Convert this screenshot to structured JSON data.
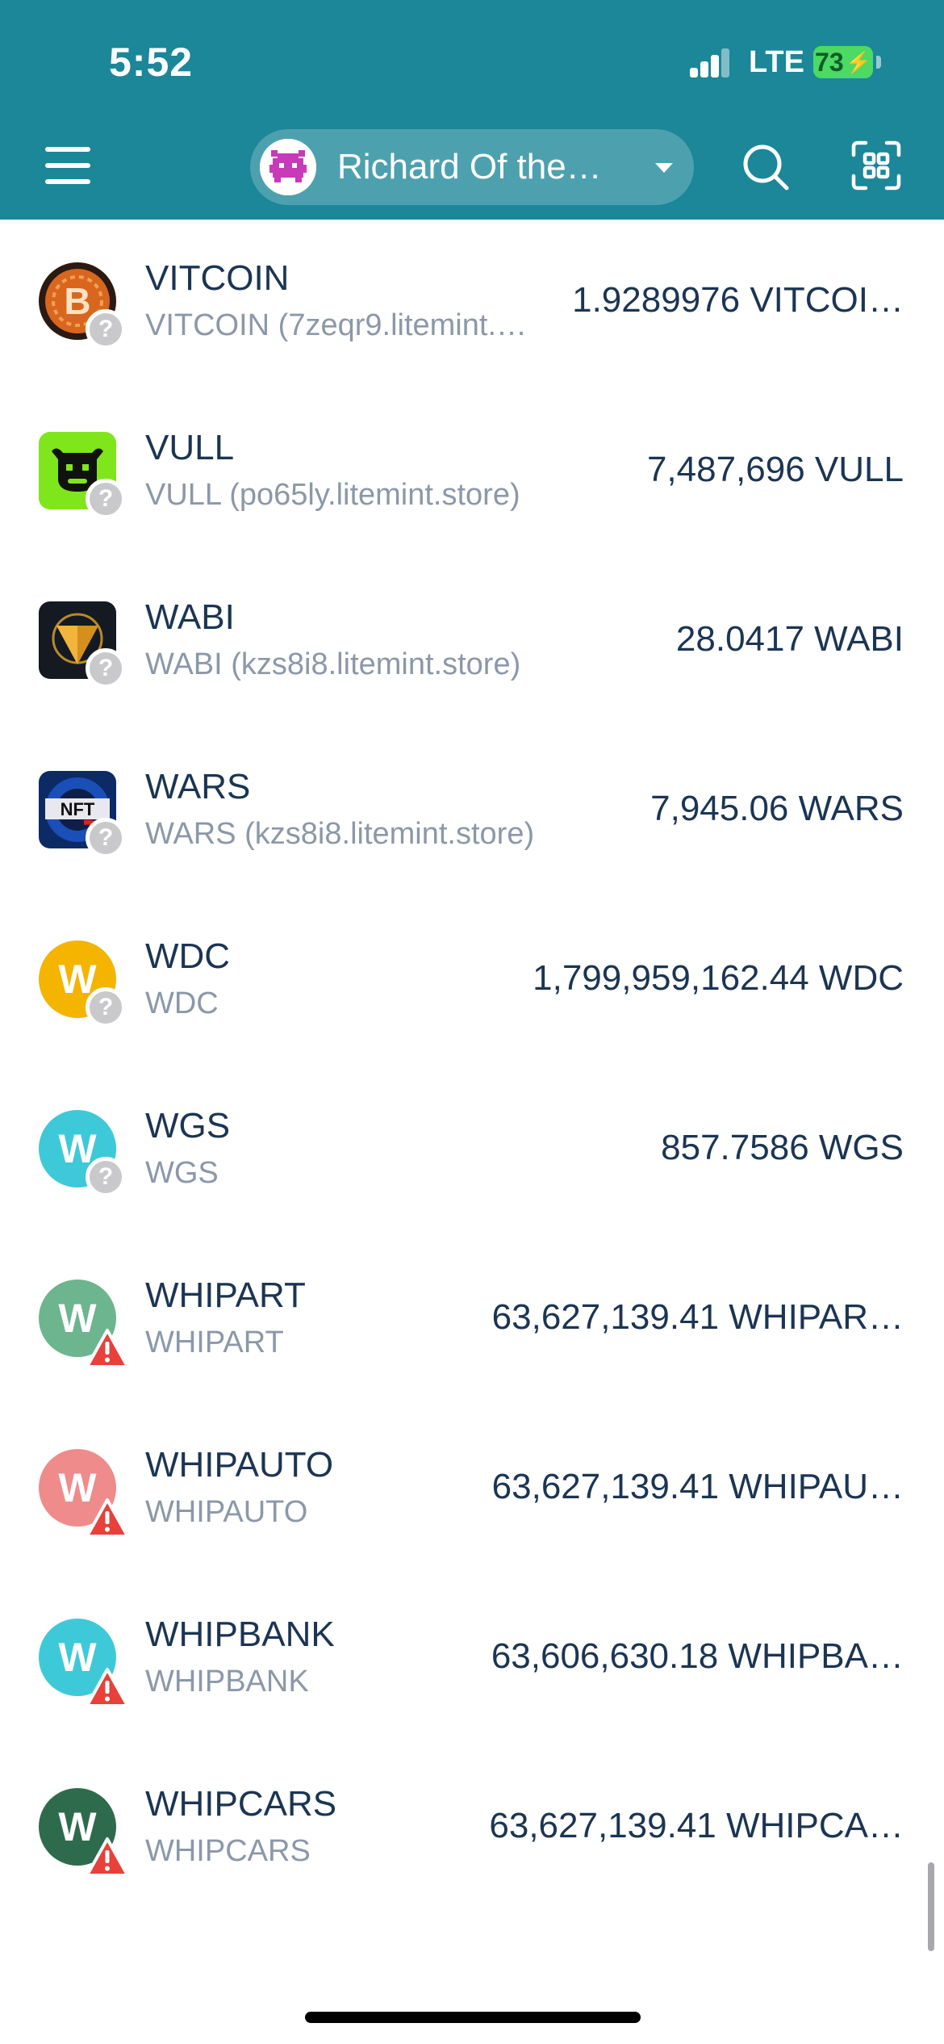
{
  "status_bar": {
    "time": "5:52",
    "network": "LTE",
    "battery": "73"
  },
  "header": {
    "account_name": "Richard Of the…"
  },
  "tokens": [
    {
      "name": "VITCOIN",
      "subtitle": "VITCOIN (7zeqr9.litemint.…",
      "balance": "1.9289976 VITCOI…",
      "icon": "bitcoin-coin-icon",
      "badge": "unknown"
    },
    {
      "name": "VULL",
      "subtitle": "VULL (po65ly.litemint.store)",
      "balance": "7,487,696 VULL",
      "icon": "bull-icon",
      "badge": "unknown"
    },
    {
      "name": "WABI",
      "subtitle": "WABI (kzs8i8.litemint.store)",
      "balance": "28.0417 WABI",
      "icon": "wabi-triangle-icon",
      "badge": "unknown"
    },
    {
      "name": "WARS",
      "subtitle": "WARS (kzs8i8.litemint.store)",
      "balance": "7,945.06 WARS",
      "icon": "nft-wars-icon",
      "badge": "unknown"
    },
    {
      "name": "WDC",
      "subtitle": "WDC",
      "balance": "1,799,959,162.44 WDC",
      "icon": "letter-w-icon",
      "letter": "W",
      "color": "#f4b400",
      "badge": "unknown"
    },
    {
      "name": "WGS",
      "subtitle": "WGS",
      "balance": "857.7586 WGS",
      "icon": "letter-w-icon",
      "letter": "W",
      "color": "#3ec9d8",
      "badge": "unknown"
    },
    {
      "name": "WHIPART",
      "subtitle": "WHIPART",
      "balance": "63,627,139.41 WHIPAR…",
      "icon": "letter-w-icon",
      "letter": "W",
      "color": "#6cb58e",
      "badge": "warning"
    },
    {
      "name": "WHIPAUTO",
      "subtitle": "WHIPAUTO",
      "balance": "63,627,139.41 WHIPAU…",
      "icon": "letter-w-icon",
      "letter": "W",
      "color": "#ef8b8b",
      "badge": "warning"
    },
    {
      "name": "WHIPBANK",
      "subtitle": "WHIPBANK",
      "balance": "63,606,630.18 WHIPBA…",
      "icon": "letter-w-icon",
      "letter": "W",
      "color": "#3ec9d8",
      "badge": "warning"
    },
    {
      "name": "WHIPCARS",
      "subtitle": "WHIPCARS",
      "balance": "63,627,139.41 WHIPCA…",
      "icon": "letter-w-icon",
      "letter": "W",
      "color": "#2e6b4d",
      "badge": "warning"
    }
  ],
  "colors": {
    "header_bg": "#1b8799",
    "text_primary": "#1b3553",
    "text_secondary": "#8c98a8",
    "warning": "#e8403a"
  }
}
